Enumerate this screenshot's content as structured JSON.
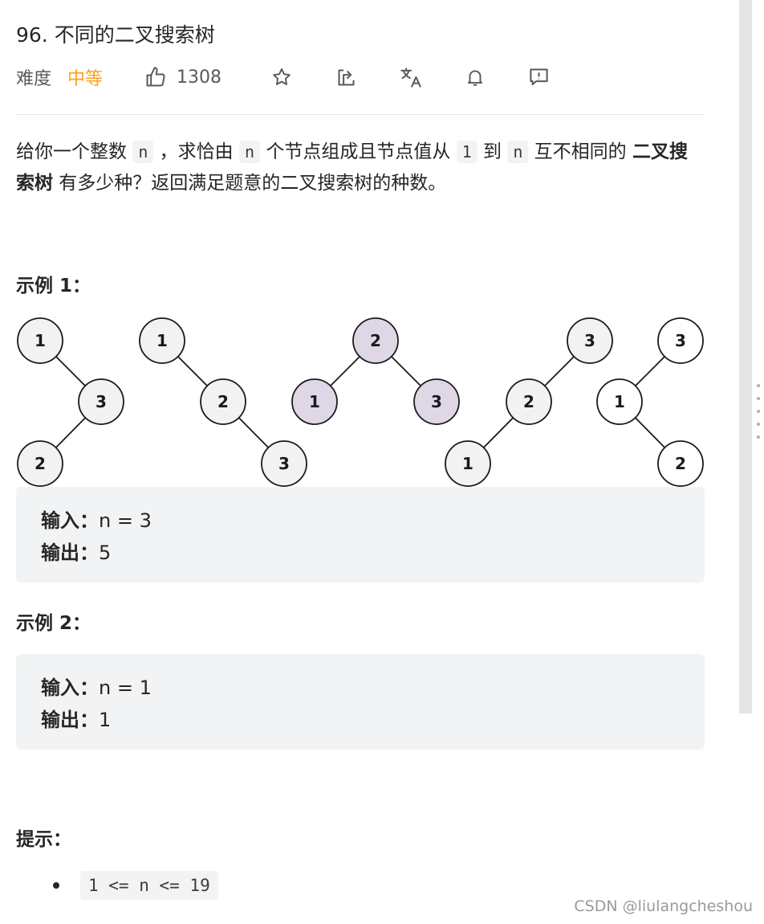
{
  "problem": {
    "title": "96. 不同的二叉搜索树",
    "difficulty_label": "难度",
    "difficulty": "中等",
    "likes": "1308"
  },
  "description": {
    "t1": "给你一个整数 ",
    "c1": "n",
    "t2": " ，求恰由 ",
    "c2": "n",
    "t3": " 个节点组成且节点值从 ",
    "c3": "1",
    "t4": " 到 ",
    "c4": "n",
    "t5": " 互不相同的 ",
    "b1": "二叉搜索树",
    "t6": " 有多少种？返回满足题意的二叉搜索树的种数。"
  },
  "example1": {
    "heading": "示例 1：",
    "input_label": "输入：",
    "input_value": "n = 3",
    "output_label": "输出：",
    "output_value": "5",
    "tree_labels": {
      "t1": [
        "1",
        "3",
        "2"
      ],
      "t2": [
        "1",
        "2",
        "3"
      ],
      "t3": [
        "2",
        "1",
        "3"
      ],
      "t4": [
        "3",
        "2",
        "1"
      ],
      "t5": [
        "3",
        "1",
        "2"
      ]
    },
    "colors": {
      "default_fill": "#f2f2f2",
      "highlight_fill": "#e0d7e6",
      "stroke": "#1a1a1a"
    }
  },
  "example2": {
    "heading": "示例 2：",
    "input_label": "输入：",
    "input_value": "n = 1",
    "output_label": "输出：",
    "output_value": "1"
  },
  "hints": {
    "heading": "提示：",
    "items": [
      "1 <= n <= 19"
    ]
  },
  "watermark": "CSDN @liulangcheshou",
  "icons": [
    "thumbs-up-icon",
    "star-icon",
    "share-icon",
    "translate-icon",
    "bell-icon",
    "feedback-icon"
  ],
  "accent": "#ffa116"
}
